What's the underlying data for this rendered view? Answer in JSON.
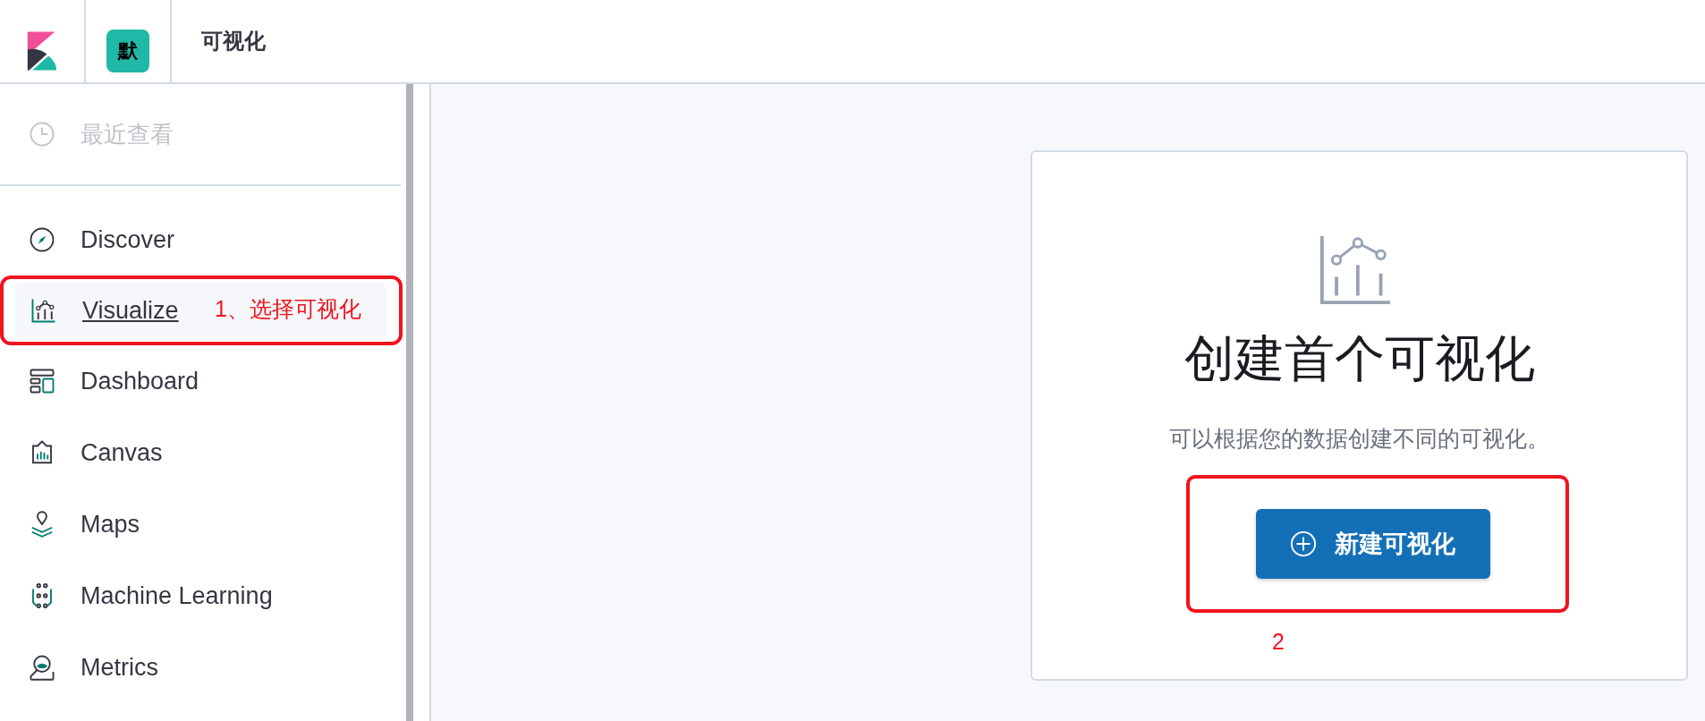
{
  "header": {
    "space_badge": "默",
    "title": "可视化"
  },
  "sidebar": {
    "recent": {
      "label": "最近查看",
      "disabled": true
    },
    "items": [
      {
        "label": "Discover",
        "selected": false
      },
      {
        "label": "Visualize",
        "selected": true
      },
      {
        "label": "Dashboard",
        "selected": false
      },
      {
        "label": "Canvas",
        "selected": false
      },
      {
        "label": "Maps",
        "selected": false
      },
      {
        "label": "Machine Learning",
        "selected": false
      },
      {
        "label": "Metrics",
        "selected": false
      }
    ]
  },
  "empty_prompt": {
    "title": "创建首个可视化",
    "description": "可以根据您的数据创建不同的可视化。",
    "button": "新建可视化"
  },
  "annotations": [
    {
      "text": "1、选择可视化"
    },
    {
      "text": "2"
    }
  ]
}
